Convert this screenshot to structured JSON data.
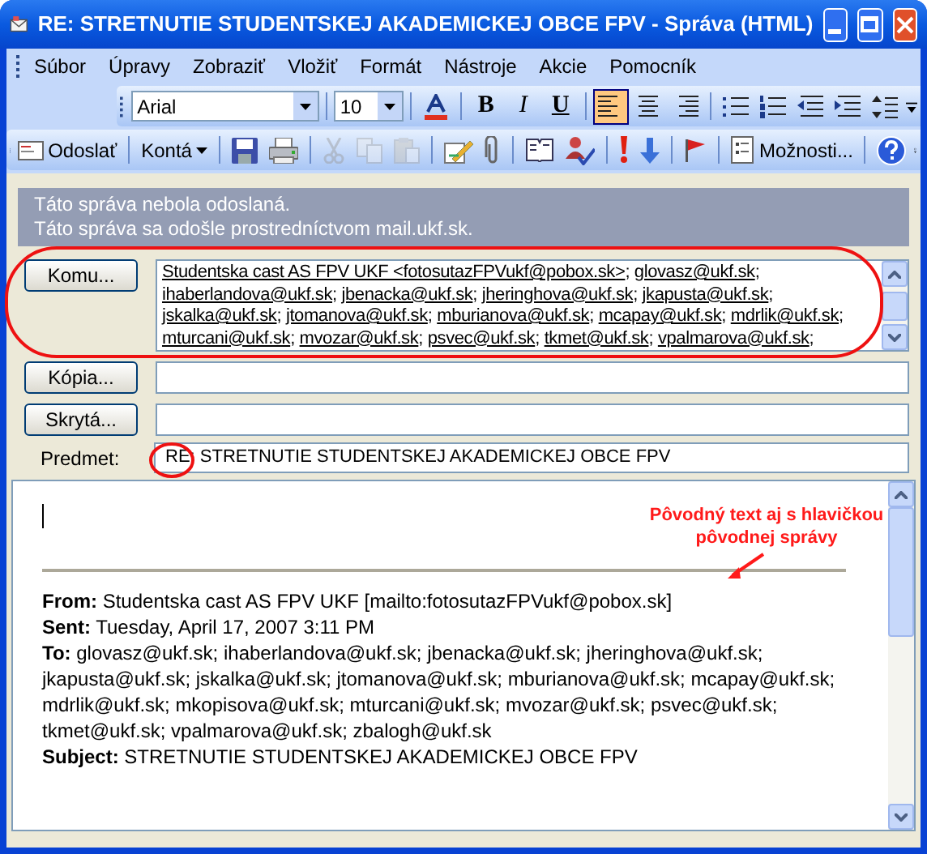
{
  "window": {
    "title": "RE: STRETNUTIE STUDENTSKEJ AKADEMICKEJ OBCE FPV - Správa (HTML)"
  },
  "menu": [
    "Súbor",
    "Úpravy",
    "Zobraziť",
    "Vložiť",
    "Formát",
    "Nástroje",
    "Akcie",
    "Pomocník"
  ],
  "format_toolbar": {
    "font": "Arial",
    "size": "10",
    "groups": [
      [
        {
          "kind": "font-color"
        }
      ],
      [
        {
          "kind": "bold",
          "label": "B"
        },
        {
          "kind": "italic",
          "label": "I"
        },
        {
          "kind": "underline",
          "label": "U"
        }
      ],
      [
        {
          "kind": "align-left",
          "selected": true
        },
        {
          "kind": "align-center",
          "selected": false
        },
        {
          "kind": "align-right",
          "selected": false
        }
      ],
      [
        {
          "kind": "bullets"
        },
        {
          "kind": "numbering"
        },
        {
          "kind": "outdent"
        },
        {
          "kind": "indent"
        },
        {
          "kind": "line-spacing"
        }
      ]
    ]
  },
  "standard_toolbar": [
    [
      {
        "kind": "send",
        "label": "Odoslať",
        "disabled": false
      }
    ],
    [
      {
        "kind": "accounts",
        "label": "Kontá",
        "disabled": false
      }
    ],
    [
      {
        "kind": "save",
        "disabled": false
      },
      {
        "kind": "print",
        "disabled": false
      }
    ],
    [
      {
        "kind": "cut",
        "disabled": true
      },
      {
        "kind": "copy",
        "disabled": true
      },
      {
        "kind": "paste",
        "disabled": true
      }
    ],
    [
      {
        "kind": "signature",
        "disabled": false
      },
      {
        "kind": "attach",
        "disabled": false
      }
    ],
    [
      {
        "kind": "address-book",
        "disabled": false
      },
      {
        "kind": "check-names",
        "disabled": false
      }
    ],
    [
      {
        "kind": "high-importance",
        "disabled": false
      },
      {
        "kind": "low-importance",
        "disabled": false
      }
    ],
    [
      {
        "kind": "flag",
        "disabled": false
      }
    ],
    [
      {
        "kind": "options",
        "label": "Možnosti...",
        "disabled": false
      }
    ],
    [
      {
        "kind": "help",
        "disabled": false
      }
    ]
  ],
  "info_bar": [
    "Táto správa nebola odoslaná.",
    "Táto správa sa odošle prostredníctvom mail.ukf.sk."
  ],
  "address_fields": [
    {
      "button": "Komu...",
      "separator": ";",
      "recipients": [
        "Studentska cast AS FPV UKF <fotosutazFPVukf@pobox.sk>",
        "glovasz@ukf.sk",
        "ihaberlandova@ukf.sk",
        "jbenacka@ukf.sk",
        "jheringhova@ukf.sk",
        "jkapusta@ukf.sk",
        "jskalka@ukf.sk",
        "jtomanova@ukf.sk",
        "mburianova@ukf.sk",
        "mcapay@ukf.sk",
        "mdrlik@ukf.sk",
        "mturcani@ukf.sk",
        "mvozar@ukf.sk",
        "psvec@ukf.sk",
        "tkmet@ukf.sk",
        "vpalmarova@ukf.sk"
      ]
    },
    {
      "button": "Kópia..."
    },
    {
      "button": "Skrytá..."
    }
  ],
  "subject": {
    "label": "Predmet:",
    "value": "RE: STRETNUTIE STUDENTSKEJ AKADEMICKEJ OBCE FPV"
  },
  "annotation": "Pôvodný text aj s hlavičkou pôvodnej správy",
  "quoted_header": [
    "**From:** Studentska cast AS FPV UKF [mailto:fotosutazFPVukf@pobox.sk]",
    "**Sent:** Tuesday, April 17, 2007 3:11 PM",
    "**To:** glovasz@ukf.sk; ihaberlandova@ukf.sk; jbenacka@ukf.sk; jheringhova@ukf.sk; jkapusta@ukf.sk; jskalka@ukf.sk; jtomanova@ukf.sk; mburianova@ukf.sk; mcapay@ukf.sk; mdrlik@ukf.sk; mkopisova@ukf.sk; mturcani@ukf.sk; mvozar@ukf.sk; psvec@ukf.sk; tkmet@ukf.sk; vpalmarova@ukf.sk; zbalogh@ukf.sk",
    "**Subject:** STRETNUTIE STUDENTSKEJ AKADEMICKEJ OBCE FPV"
  ]
}
